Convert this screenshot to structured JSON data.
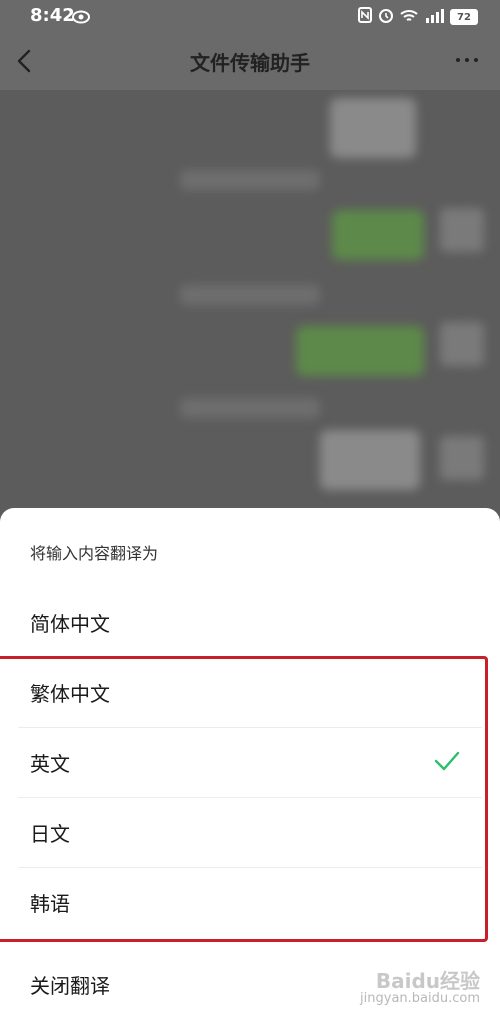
{
  "status_bar": {
    "time": "8:42",
    "battery": "72"
  },
  "nav": {
    "title": "文件传输助手"
  },
  "sheet": {
    "title": "将输入内容翻译为",
    "options": [
      {
        "label": "简体中文",
        "selected": false
      },
      {
        "label": "繁体中文",
        "selected": false
      },
      {
        "label": "英文",
        "selected": true
      },
      {
        "label": "日文",
        "selected": false
      },
      {
        "label": "韩语",
        "selected": false
      },
      {
        "label": "关闭翻译",
        "selected": false
      }
    ]
  },
  "watermark": {
    "brand": "Baidu经验",
    "url": "jingyan.baidu.com"
  },
  "colors": {
    "check": "#2bbf6a",
    "highlight": "#c8202a"
  }
}
